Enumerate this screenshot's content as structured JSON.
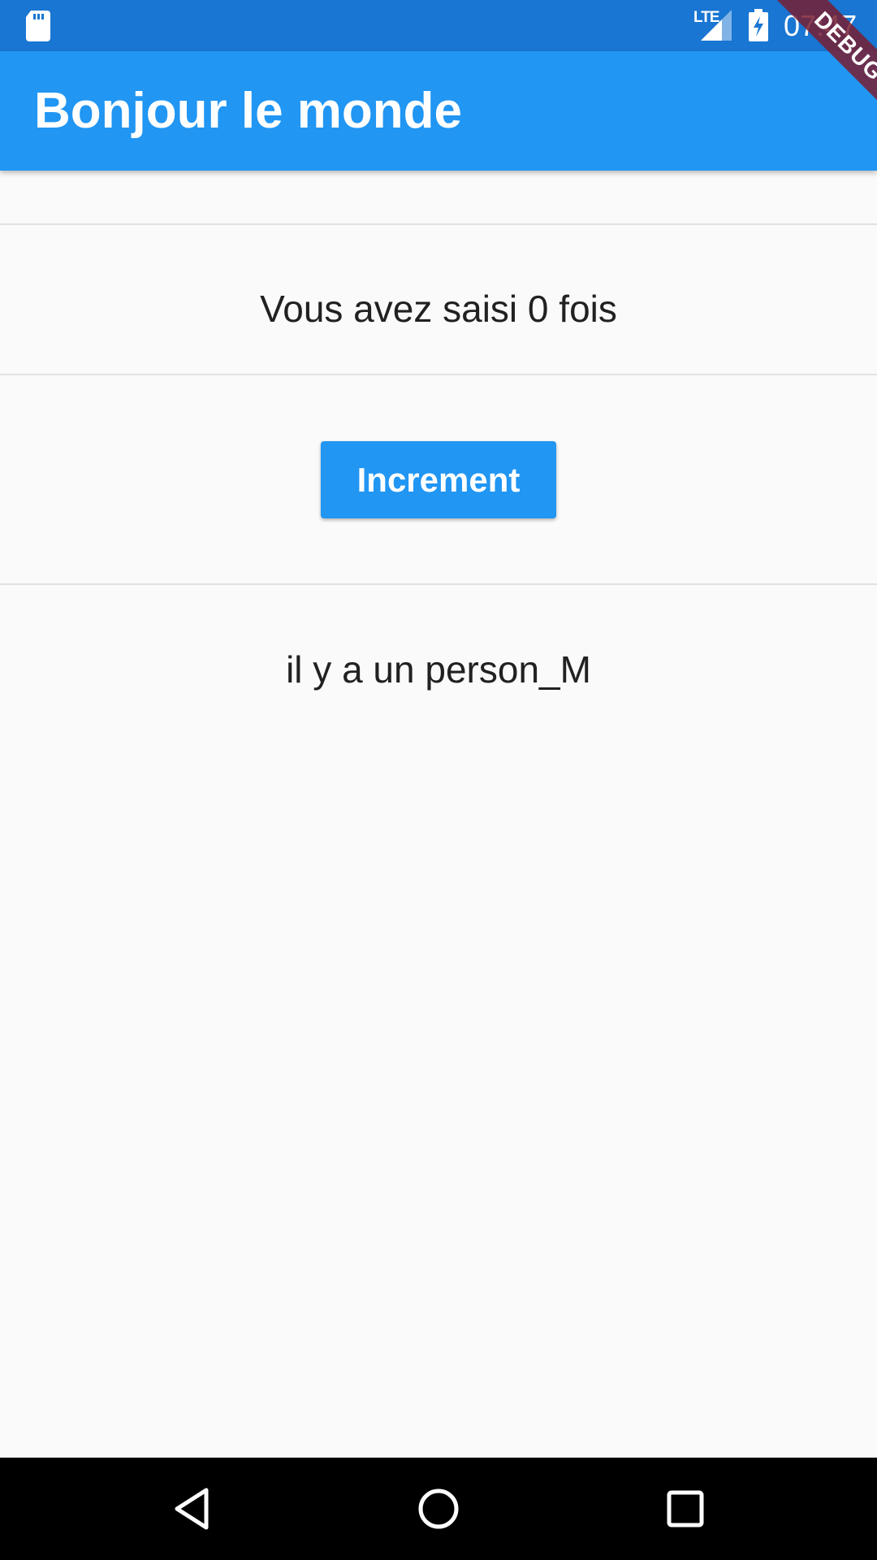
{
  "status_bar": {
    "time": "07:47",
    "network": "LTE",
    "icons": [
      "sd-card-icon",
      "signal-icon",
      "battery-charging-icon"
    ]
  },
  "app_bar": {
    "title": "Bonjour le monde"
  },
  "debug_banner": {
    "label": "DEBUG"
  },
  "main": {
    "counter_text": "Vous avez saisi 0 fois",
    "increment_button_label": "Increment",
    "person_text": "il y a un person_M"
  },
  "nav_bar": {
    "buttons": [
      "back-icon",
      "home-icon",
      "recents-icon"
    ]
  },
  "colors": {
    "status_bar": "#1976d2",
    "app_bar": "#2196f3",
    "button": "#2196f3",
    "background": "#fafafa",
    "nav_bar": "#000000",
    "debug_ribbon": "#7a1e32"
  }
}
